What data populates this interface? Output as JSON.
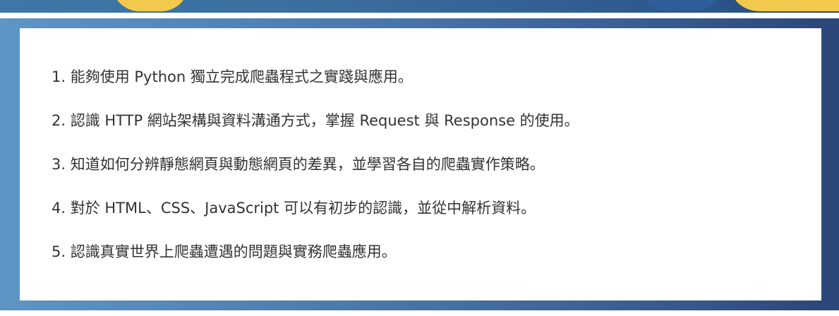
{
  "goals": [
    "1. 能夠使用 Python 獨立完成爬蟲程式之實踐與應用。",
    "2. 認識 HTTP 網站架構與資料溝通方式，掌握 Request 與 Response 的使用。",
    "3. 知道如何分辨靜態網頁與動態網頁的差異，並學習各自的爬蟲實作策略。",
    "4. 對於 HTML、CSS、JavaScript 可以有初步的認識，並從中解析資料。",
    "5. 認識真實世界上爬蟲遭遇的問題與實務爬蟲應用。"
  ],
  "colors": {
    "frame_start": "#5d95c5",
    "frame_end": "#2b4678",
    "accent_yellow": "#f2c94c",
    "text": "#333333"
  }
}
